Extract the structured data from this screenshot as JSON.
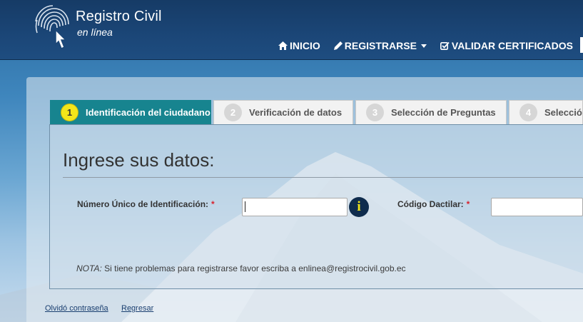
{
  "brand": {
    "title": "Registro Civil",
    "subtitle": "en línea",
    "logo_icon": "fingerprint-hand-icon"
  },
  "nav": {
    "items": [
      {
        "label": "INICIO",
        "icon": "home-icon"
      },
      {
        "label": "REGISTRARSE",
        "icon": "pencil-icon"
      },
      {
        "label": "VALIDAR CERTIFICADOS",
        "icon": "check-square-icon"
      }
    ]
  },
  "wizard": {
    "tabs": [
      {
        "number": "1",
        "label": "Identificación del ciudadano",
        "active": true
      },
      {
        "number": "2",
        "label": "Verificación de datos",
        "active": false
      },
      {
        "number": "3",
        "label": "Selección de Preguntas",
        "active": false
      },
      {
        "number": "4",
        "label": "Selecció",
        "active": false
      }
    ]
  },
  "form": {
    "title": "Ingrese sus datos:",
    "id_label": "Número Único de Identificación:",
    "id_value": "",
    "fingerprint_label": "Código Dactilar:",
    "fingerprint_value": "",
    "required_mark": "*",
    "info_glyph": "i",
    "note_prefix": "NOTA:",
    "note_text": " Si tiene problemas para registrarse favor escriba a enlinea@registrocivil.gob.ec"
  },
  "footer": {
    "forgot_password": "Olvidó contraseña",
    "back": "Regresar"
  },
  "colors": {
    "header": "#1b4677",
    "active_tab": "#17848f",
    "step_badge": "#f3e61a",
    "required": "#d9232e"
  }
}
